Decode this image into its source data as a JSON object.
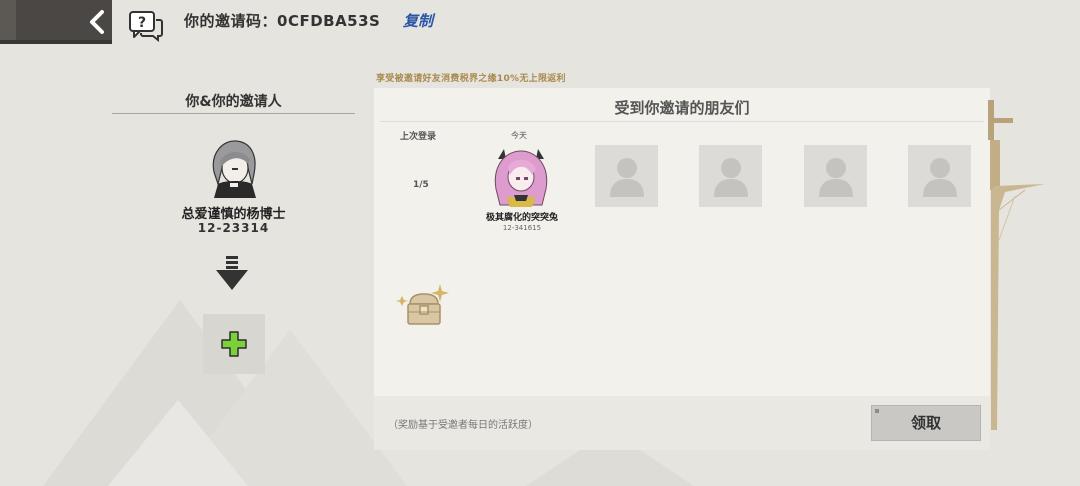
{
  "header": {
    "invite_code_label": "你的邀请码：0CFDBA53S",
    "copy_label": "复制"
  },
  "left_panel": {
    "title": "你&你的邀请人",
    "inviter_name": "总爱谨慎的杨博士",
    "inviter_id": "12-23314"
  },
  "banner_text": "享受被邀请好友消费税界之缘10%无上限返利",
  "friends_panel": {
    "title": "受到你邀请的朋友们",
    "last_login_label": "上次登录",
    "count": "1/5",
    "friends": [
      {
        "login": "今天",
        "name": "极其腐化的突突兔",
        "id": "12-341615"
      }
    ]
  },
  "footer": {
    "reward_note": "（奖励基于受邀者每日的活跃度）",
    "claim_label": "领取"
  },
  "colors": {
    "background": "#e6e4df",
    "panel": "#f2f1ec",
    "copy_link": "#2b56a8",
    "banner": "#a98a4e",
    "plus": "#7ad13a",
    "deco_gold": "#b8a27a"
  }
}
